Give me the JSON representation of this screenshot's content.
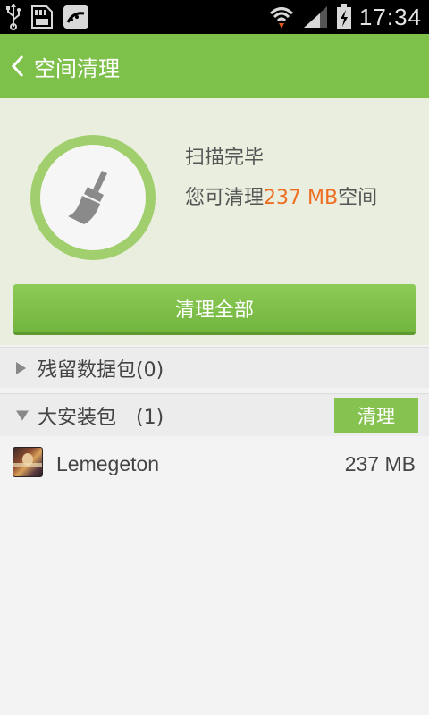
{
  "status_bar": {
    "time": "17:34",
    "icons": [
      "usb-icon",
      "sd-card-icon",
      "cleaner-notification-icon",
      "wifi-icon",
      "signal-icon",
      "battery-charging-icon"
    ]
  },
  "header": {
    "title": "空间清理",
    "back_icon": "chevron-left-icon"
  },
  "summary": {
    "status": "扫描完毕",
    "cleanable_prefix": "您可清理",
    "cleanable_size": "237 MB",
    "cleanable_suffix": "空间",
    "clean_all_label": "清理全部",
    "icon": "broom-icon"
  },
  "sections": [
    {
      "label": "残留数据包(0)",
      "expanded": false
    },
    {
      "label": "大安装包　(1)",
      "expanded": true,
      "action_label": "清理"
    }
  ],
  "items": [
    {
      "name": "Lemegeton",
      "size": "237 MB"
    }
  ],
  "colors": {
    "accent": "#7dc04a",
    "highlight": "#ee6e22",
    "panel": "#e9eedf"
  }
}
